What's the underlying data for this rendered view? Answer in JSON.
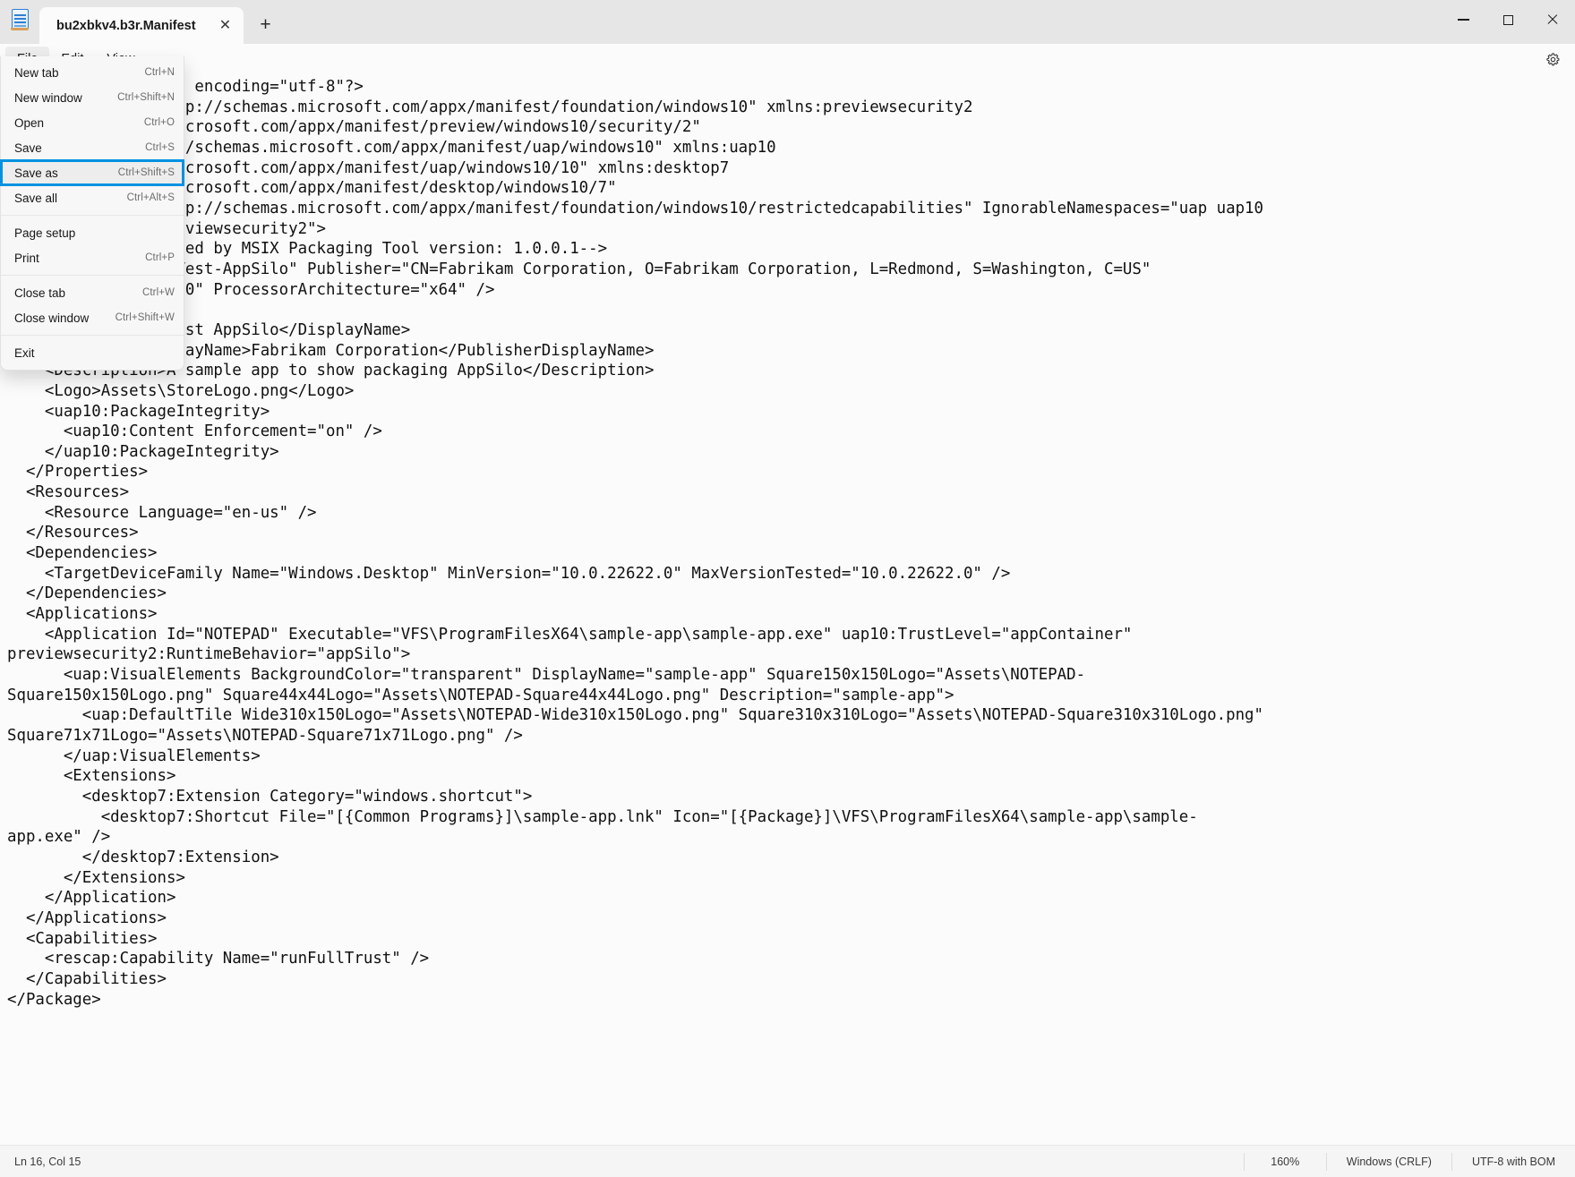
{
  "window": {
    "tab_title": "bu2xbkv4.b3r.Manifest",
    "app_icon": "notepad-icon",
    "close_tab_glyph": "✕",
    "new_tab_glyph": "+",
    "minimize_label": "Minimize",
    "maximize_label": "Maximize",
    "close_label": "Close"
  },
  "menubar": {
    "items": [
      {
        "label": "File"
      },
      {
        "label": "Edit"
      },
      {
        "label": "View"
      }
    ],
    "settings_icon": "gear-icon"
  },
  "file_menu": {
    "items": [
      {
        "label": "New tab",
        "accel": "Ctrl+N",
        "sep_after": false,
        "highlight": false
      },
      {
        "label": "New window",
        "accel": "Ctrl+Shift+N",
        "sep_after": false,
        "highlight": false
      },
      {
        "label": "Open",
        "accel": "Ctrl+O",
        "sep_after": false,
        "highlight": false
      },
      {
        "label": "Save",
        "accel": "Ctrl+S",
        "sep_after": false,
        "highlight": false
      },
      {
        "label": "Save as",
        "accel": "Ctrl+Shift+S",
        "sep_after": false,
        "highlight": true
      },
      {
        "label": "Save all",
        "accel": "Ctrl+Alt+S",
        "sep_after": true,
        "highlight": false
      },
      {
        "label": "Page setup",
        "accel": "",
        "sep_after": false,
        "highlight": false
      },
      {
        "label": "Print",
        "accel": "Ctrl+P",
        "sep_after": true,
        "highlight": false
      },
      {
        "label": "Close tab",
        "accel": "Ctrl+W",
        "sep_after": false,
        "highlight": false
      },
      {
        "label": "Close window",
        "accel": "Ctrl+Shift+W",
        "sep_after": true,
        "highlight": false
      },
      {
        "label": "Exit",
        "accel": "",
        "sep_after": false,
        "highlight": false
      }
    ],
    "highlight_color": "#0092e0"
  },
  "editor": {
    "content": "<?xml version=\"1.0\" encoding=\"utf-8\"?>\n<Package xmlns=\"http://schemas.microsoft.com/appx/manifest/foundation/windows10\" xmlns:previewsecurity2\n=\"http://schemas.microsoft.com/appx/manifest/preview/windows10/security/2\"\n  xmlns:uap=\"http://schemas.microsoft.com/appx/manifest/uap/windows10\" xmlns:uap10\n=\"http://schemas.microsoft.com/appx/manifest/uap/windows10/10\" xmlns:desktop7\n=\"http://schemas.microsoft.com/appx/manifest/desktop/windows10/7\"\n  xmlns:rescap=\"http://schemas.microsoft.com/appx/manifest/foundation/windows10/restrictedcapabilities\" IgnorableNamespaces=\"uap uap10\nrescap desktop7 previewsecurity2\">\n  <!--Package created by MSIX Packaging Tool version: 1.0.0.1-->\n  <Identity Name=\"Test-AppSilo\" Publisher=\"CN=Fabrikam Corporation, O=Fabrikam Corporation, L=Redmond, S=Washington, C=US\"\n    Version=\"1.0.0.0\" ProcessorArchitecture=\"x64\" />\n  <Properties>\n    <DisplayName>Test AppSilo</DisplayName>\n    <PublisherDisplayName>Fabrikam Corporation</PublisherDisplayName>\n    <Description>A sample app to show packaging AppSilo</Description>\n    <Logo>Assets\\StoreLogo.png</Logo>\n    <uap10:PackageIntegrity>\n      <uap10:Content Enforcement=\"on\" />\n    </uap10:PackageIntegrity>\n  </Properties>\n  <Resources>\n    <Resource Language=\"en-us\" />\n  </Resources>\n  <Dependencies>\n    <TargetDeviceFamily Name=\"Windows.Desktop\" MinVersion=\"10.0.22622.0\" MaxVersionTested=\"10.0.22622.0\" />\n  </Dependencies>\n  <Applications>\n    <Application Id=\"NOTEPAD\" Executable=\"VFS\\ProgramFilesX64\\sample-app\\sample-app.exe\" uap10:TrustLevel=\"appContainer\"\npreviewsecurity2:RuntimeBehavior=\"appSilo\">\n      <uap:VisualElements BackgroundColor=\"transparent\" DisplayName=\"sample-app\" Square150x150Logo=\"Assets\\NOTEPAD-\nSquare150x150Logo.png\" Square44x44Logo=\"Assets\\NOTEPAD-Square44x44Logo.png\" Description=\"sample-app\">\n        <uap:DefaultTile Wide310x150Logo=\"Assets\\NOTEPAD-Wide310x150Logo.png\" Square310x310Logo=\"Assets\\NOTEPAD-Square310x310Logo.png\"\nSquare71x71Logo=\"Assets\\NOTEPAD-Square71x71Logo.png\" />\n      </uap:VisualElements>\n      <Extensions>\n        <desktop7:Extension Category=\"windows.shortcut\">\n          <desktop7:Shortcut File=\"[{Common Programs}]\\sample-app.lnk\" Icon=\"[{Package}]\\VFS\\ProgramFilesX64\\sample-app\\sample-\napp.exe\" />\n        </desktop7:Extension>\n      </Extensions>\n    </Application>\n  </Applications>\n  <Capabilities>\n    <rescap:Capability Name=\"runFullTrust\" />\n  </Capabilities>\n</Package>"
  },
  "statusbar": {
    "cursor_position": "Ln 16, Col 15",
    "zoom": "160%",
    "line_ending": "Windows (CRLF)",
    "encoding": "UTF-8 with BOM"
  }
}
